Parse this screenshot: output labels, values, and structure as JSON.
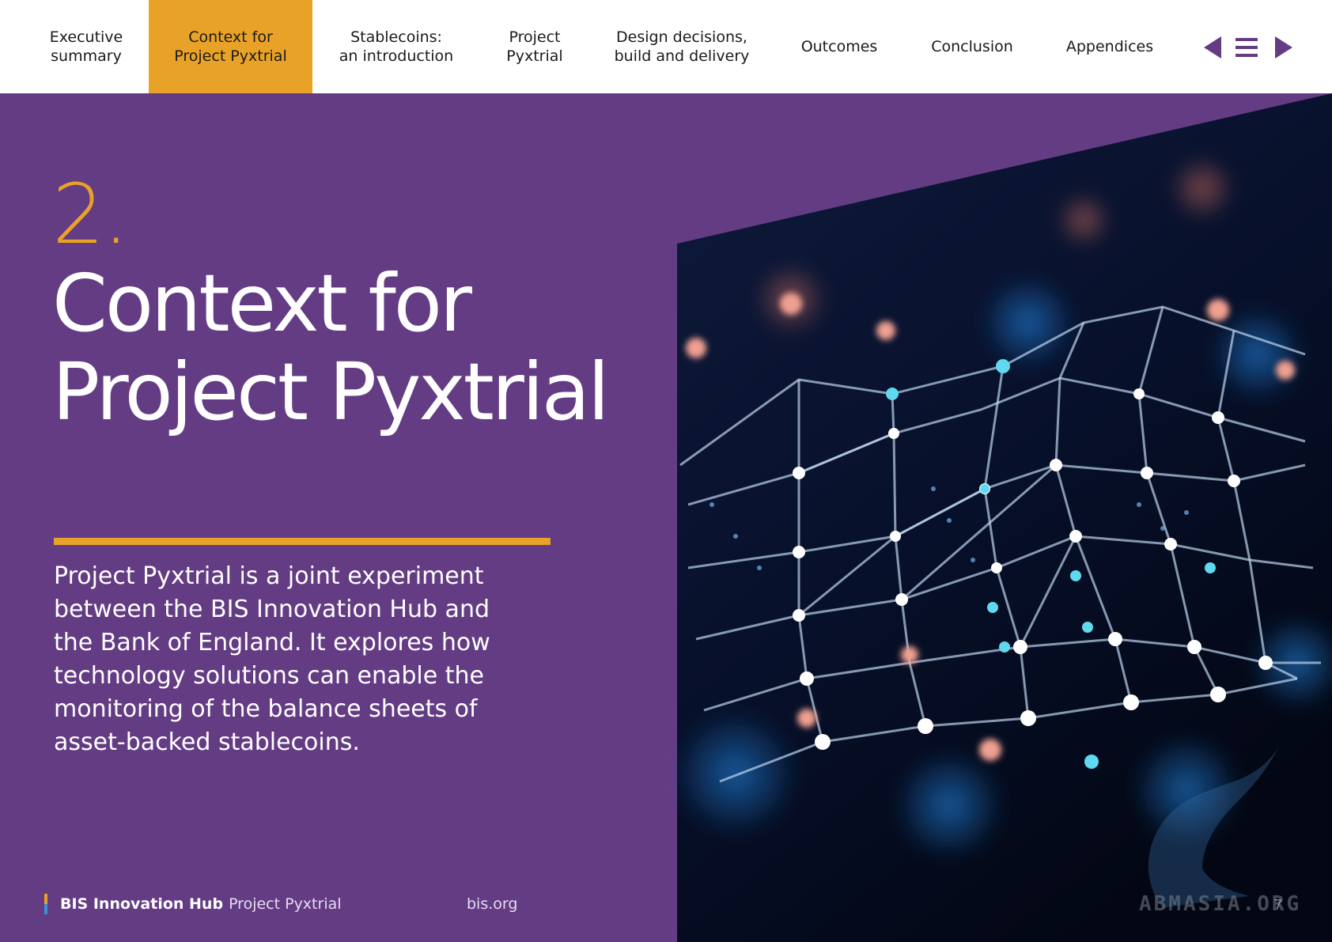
{
  "nav": {
    "items": [
      {
        "label": "Executive\nsummary"
      },
      {
        "label": "Context for\nProject Pyxtrial",
        "active": true
      },
      {
        "label": "Stablecoins:\nan introduction"
      },
      {
        "label": "Project\nPyxtrial"
      },
      {
        "label": "Design decisions,\nbuild and delivery"
      },
      {
        "label": "Outcomes"
      },
      {
        "label": "Conclusion"
      },
      {
        "label": "Appendices"
      }
    ],
    "controls": {
      "previous": "arrow-left-icon",
      "menu": "hamburger-menu-icon",
      "next": "arrow-right-icon"
    },
    "active_color": "#E9A228",
    "icon_color": "#643C84"
  },
  "hero": {
    "section_number": "2.",
    "title": "Context for Project Pyxtrial",
    "intro": "Project Pyxtrial is a joint experiment between the BIS Innovation Hub and the Bank of England. It explores how technology solutions can enable the monitoring of the balance sheets of asset-backed stablecoins.",
    "background_color": "#643C84",
    "accent_color": "#E9A228"
  },
  "footer": {
    "org": "BIS Innovation Hub",
    "project": "Project Pyxtrial",
    "url": "bis.org",
    "page_number": "7"
  },
  "watermark": "ABMASIA.ORG"
}
